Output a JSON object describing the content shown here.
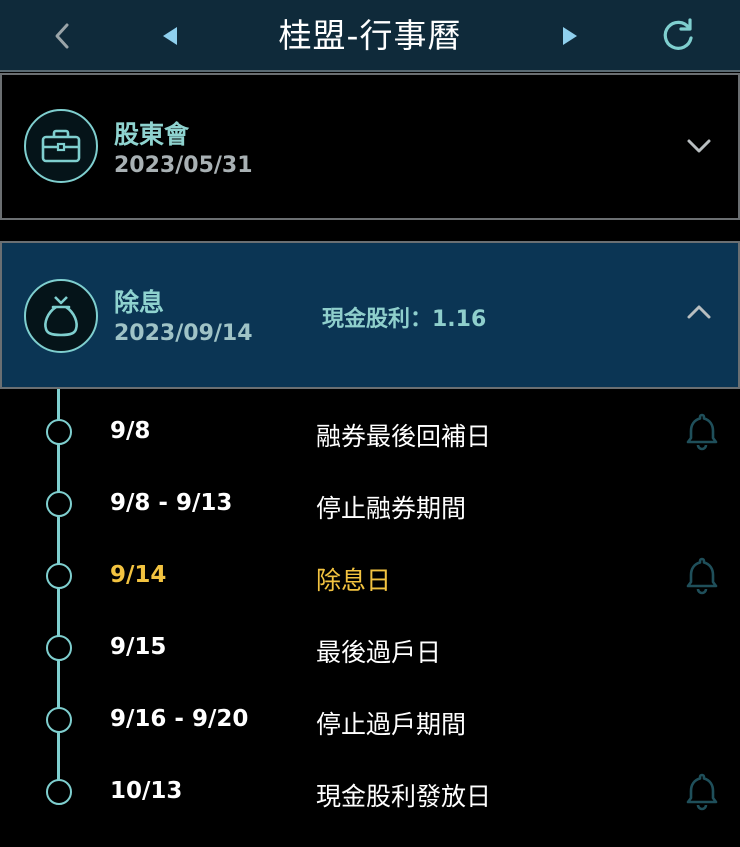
{
  "header": {
    "title": "桂盟-行事曆",
    "back_icon": "chevron-left-icon",
    "prev_icon": "triangle-left-icon",
    "next_icon": "triangle-right-icon",
    "refresh_icon": "refresh-icon"
  },
  "events": [
    {
      "title": "股東會",
      "date": "2023/05/31",
      "icon": "briefcase-icon",
      "expanded": false
    },
    {
      "title": "除息",
      "date": "2023/09/14",
      "extra": "現金股利：1.16",
      "icon": "money-bag-icon",
      "expanded": true
    }
  ],
  "timeline": [
    {
      "date": "9/8",
      "label": "融券最後回補日",
      "bell": true,
      "highlight": false
    },
    {
      "date": "9/8 - 9/13",
      "label": "停止融券期間",
      "bell": false,
      "highlight": false
    },
    {
      "date": "9/14",
      "label": "除息日",
      "bell": true,
      "highlight": true
    },
    {
      "date": "9/15",
      "label": "最後過戶日",
      "bell": false,
      "highlight": false
    },
    {
      "date": "9/16 - 9/20",
      "label": "停止過戶期間",
      "bell": false,
      "highlight": false
    },
    {
      "date": "10/13",
      "label": "現金股利發放日",
      "bell": true,
      "highlight": false
    }
  ],
  "colors": {
    "header_bg": "#0f2a3a",
    "accent_teal": "#7fcfcf",
    "expanded_bg": "#0b3554",
    "highlight": "#f3c340",
    "bell": "#1f4f5a"
  }
}
